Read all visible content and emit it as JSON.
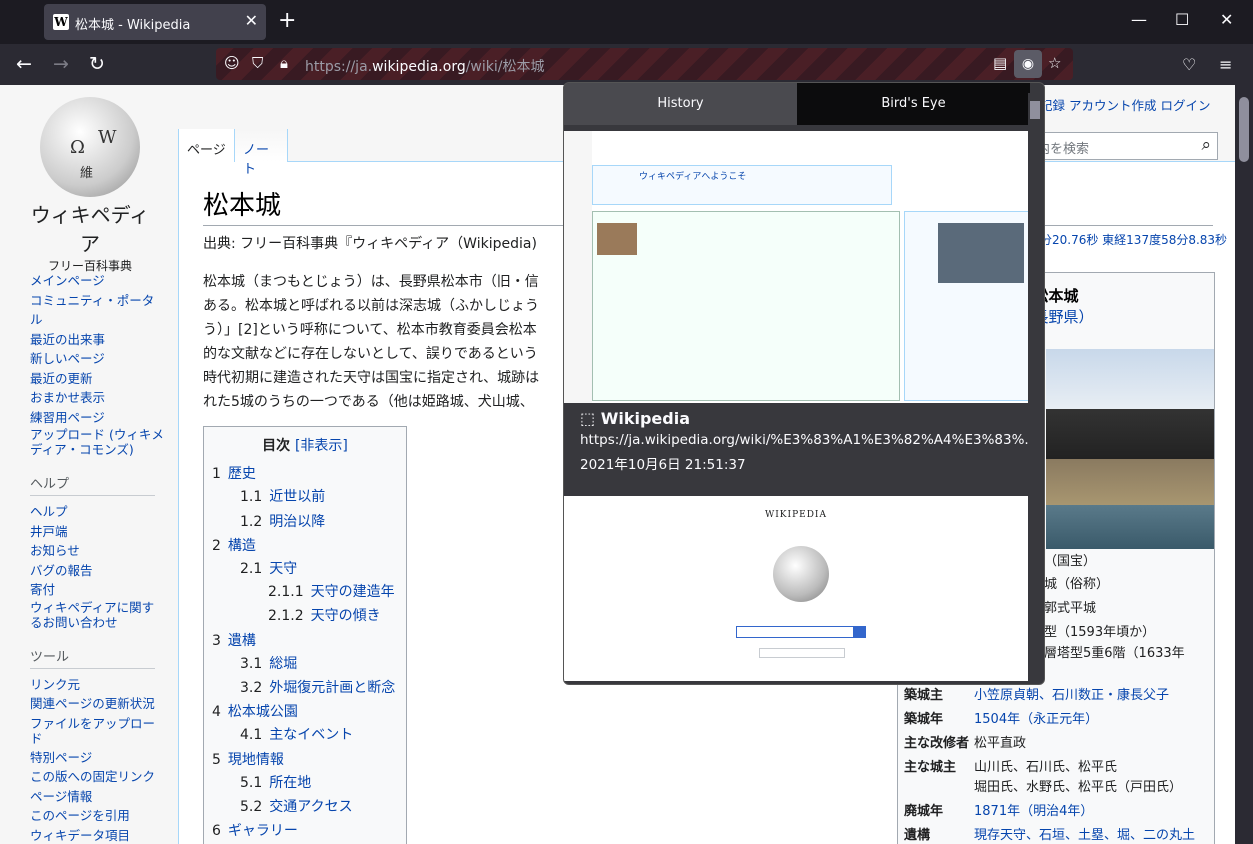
{
  "browser": {
    "tab_title": "松本城 - Wikipedia",
    "url_prefix": "https://ja.",
    "url_host": "wikipedia.org",
    "url_path": "/wiki/松本城"
  },
  "sidebar": {
    "wordmark": "ウィキペディア",
    "tagline": "フリー百科事典",
    "nav": [
      "メインページ",
      "コミュニティ・ポータル",
      "最近の出来事",
      "新しいページ",
      "最近の更新",
      "おまかせ表示",
      "練習用ページ",
      "アップロード (ウィキメディア・コモンズ)"
    ],
    "help_heading": "ヘルプ",
    "help": [
      "ヘルプ",
      "井戸端",
      "お知らせ",
      "バグの報告",
      "寄付",
      "ウィキペディアに関するお問い合わせ"
    ],
    "tools_heading": "ツール",
    "tools": [
      "リンク元",
      "関連ページの更新状況",
      "ファイルをアップロード",
      "特別ページ",
      "この版への固定リンク",
      "ページ情報",
      "このページを引用",
      "ウィキデータ項目"
    ]
  },
  "header": {
    "tab_page": "ページ",
    "tab_note": "ノート",
    "toplinks": "記録  アカウント作成  ログイン",
    "search_placeholder": "内を検索",
    "coord": "分20.76秒 東経137度58分8.83秒"
  },
  "article": {
    "title": "松本城",
    "source": "出典: フリー百科事典『ウィキペディア（Wikipedia)",
    "para_lines": [
      "松本城（まつもとじょう）は、長野県松本市（旧・信",
      "ある。松本城と呼ばれる以前は深志城（ふかしじょう",
      "う）」[2]という呼称について、松本市教育委員会松本",
      "的な文献などに存在しないとして、誤りであるという",
      "時代初期に建造された天守は国宝に指定され、城跡は",
      "れた5城のうちの一つである（他は姫路城、犬山城、"
    ]
  },
  "toc": {
    "title": "目次",
    "toggle": "[非表示]",
    "items": [
      {
        "num": "1",
        "label": "歴史"
      },
      {
        "num": "1.1",
        "label": "近世以前"
      },
      {
        "num": "1.2",
        "label": "明治以降"
      },
      {
        "num": "2",
        "label": "構造"
      },
      {
        "num": "2.1",
        "label": "天守"
      },
      {
        "num": "2.1.1",
        "label": "天守の建造年"
      },
      {
        "num": "2.1.2",
        "label": "天守の傾き"
      },
      {
        "num": "3",
        "label": "遺構"
      },
      {
        "num": "3.1",
        "label": "総堀"
      },
      {
        "num": "3.2",
        "label": "外堀復元計画と断念"
      },
      {
        "num": "4",
        "label": "松本城公園"
      },
      {
        "num": "4.1",
        "label": "主なイベント"
      },
      {
        "num": "5",
        "label": "現地情報"
      },
      {
        "num": "5.1",
        "label": "所在地"
      },
      {
        "num": "5.2",
        "label": "交通アクセス"
      },
      {
        "num": "6",
        "label": "ギャラリー"
      }
    ]
  },
  "infobox": {
    "title": "松本城",
    "subtitle": "（長野県）",
    "partial": [
      "（国宝）",
      "城（俗称）",
      "郭式平城",
      "型（1593年頃か）",
      "層塔型5重6階（1633年"
    ],
    "rows": [
      {
        "k": "築城主",
        "v": "小笠原貞朝、石川数正・康長父子"
      },
      {
        "k": "築城年",
        "v": "1504年（永正元年）"
      },
      {
        "k": "主な改修者",
        "v": "松平直政"
      },
      {
        "k": "主な城主",
        "v": "山川氏、石川氏、松平氏"
      },
      {
        "k": "",
        "v": "堀田氏、水野氏、松平氏（戸田氏）"
      },
      {
        "k": "廃城年",
        "v": "1871年（明治4年）"
      },
      {
        "k": "遺構",
        "v": "現存天守、石垣、土塁、堀、二の丸土"
      }
    ]
  },
  "popup": {
    "tab_history": "History",
    "tab_birds_eye": "Bird's Eye",
    "item_title": "Wikipedia",
    "item_url": "https://ja.wikipedia.org/wiki/%E3%83%A1%E3%82%A4%E3%83%...",
    "item_date": "2021年10月6日 21:51:37",
    "thumb_welcome": "ウィキペディアへようこそ",
    "thumb_wordmark": "WIKIPEDIA"
  }
}
